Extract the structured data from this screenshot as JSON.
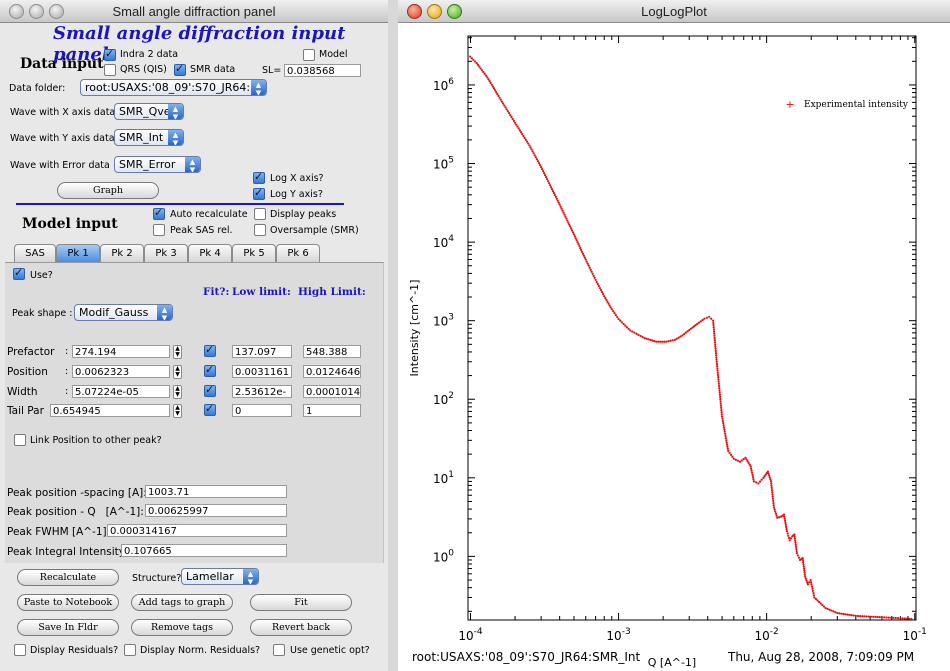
{
  "panel": {
    "window_title": "Small angle diffraction panel",
    "header": "Small angle diffraction input panel",
    "data_input": {
      "section_title": "Data input",
      "indra2_label": "Indra 2 data",
      "qrs_label": "QRS (QIS)",
      "smr_label": "SMR data",
      "model_label": "Model",
      "sl_label": "SL=",
      "sl_value": "0.038568",
      "data_folder_label": "Data folder:",
      "data_folder_value": "root:USAXS:'08_09':S70_JR64:",
      "x_wave_label": "Wave with X axis data",
      "x_wave_value": "SMR_Qvec",
      "y_wave_label": "Wave with Y axis data",
      "y_wave_value": "SMR_Int",
      "err_wave_label": "Wave with Error data",
      "err_wave_value": "SMR_Error",
      "graph_button": "Graph",
      "log_x_label": "Log X axis?",
      "log_y_label": "Log Y axis?"
    },
    "model_input": {
      "section_title": "Model input",
      "auto_recalc_label": "Auto recalculate",
      "display_peaks_label": "Display peaks",
      "peak_sas_label": "Peak SAS rel.",
      "oversample_label": "Oversample (SMR)",
      "tabs": [
        "SAS",
        "Pk 1",
        "Pk 2",
        "Pk 3",
        "Pk 4",
        "Pk 5",
        "Pk 6"
      ],
      "use_label": "Use?",
      "fit_header": "Fit?:",
      "low_header": "Low limit:",
      "high_header": "High Limit:",
      "peak_shape_label": "Peak shape :",
      "peak_shape_value": "Modif_Gauss",
      "params": [
        {
          "label": "Prefactor",
          "value": "274.194",
          "low": "137.097",
          "high": "548.388"
        },
        {
          "label": "Position",
          "value": "0.0062323",
          "low": "0.0031161",
          "high": "0.0124646"
        },
        {
          "label": "Width",
          "value": "5.07224e-05",
          "low": "2.53612e-",
          "high": "0.0001014"
        },
        {
          "label": "Tail Par",
          "value": "0.654945",
          "low": "0",
          "high": "1"
        }
      ],
      "link_label": "Link Position to other peak?",
      "results": [
        {
          "label": "Peak position -spacing [A]:",
          "value": "1003.71"
        },
        {
          "label": "Peak position - Q   [A^-1]:",
          "value": "0.00625997"
        },
        {
          "label": "Peak FWHM [A^-1]:",
          "value": "0.000314167"
        },
        {
          "label": "Peak Integral Intensity:",
          "value": "0.107665"
        }
      ]
    },
    "buttons": {
      "recalculate": "Recalculate",
      "structure_label": "Structure?",
      "structure_value": "Lamellar",
      "paste_notebook": "Paste to Notebook",
      "add_tags": "Add tags to graph",
      "fit": "Fit",
      "save_fldr": "Save In Fldr",
      "remove_tags": "Remove tags",
      "revert_back": "Revert back",
      "display_residuals": "Display Residuals?",
      "display_norm_residuals": "Display Norm. Residuals?",
      "use_genetic": "Use genetic opt?"
    }
  },
  "graph": {
    "window_title": "LogLogPlot",
    "footer_left": "root:USAXS:'08_09':S70_JR64:SMR_Int",
    "footer_right": "Thu, Aug 28, 2008, 7:09:09 PM"
  },
  "chart_data": {
    "type": "scatter",
    "title": "",
    "xlabel": "Q [A^-1]",
    "ylabel": "Intensity [cm^-1]",
    "xscale": "log",
    "yscale": "log",
    "xlim": [
      9.62e-05,
      0.102
    ],
    "ylim": [
      0.155,
      4200000
    ],
    "xticks": [
      "10^-4",
      "10^-3",
      "10^-2",
      "10^-1"
    ],
    "yticks": [
      "10^0",
      "10^1",
      "10^2",
      "10^3",
      "10^4",
      "10^5",
      "10^6"
    ],
    "legend": "top-right",
    "grid": false,
    "color": "#e01010",
    "series": [
      {
        "name": "Experimental intensity",
        "points": [
          [
            9.95e-05,
            2300000
          ],
          [
            0.00011,
            1900000
          ],
          [
            0.00013,
            1250000
          ],
          [
            0.00016,
            650000
          ],
          [
            0.0002,
            330000
          ],
          [
            0.00025,
            170000
          ],
          [
            0.0003,
            90000
          ],
          [
            0.00035,
            50000
          ],
          [
            0.0004,
            30000
          ],
          [
            0.0005,
            12500
          ],
          [
            0.0006,
            6000
          ],
          [
            0.0007,
            3300
          ],
          [
            0.0008,
            2050
          ],
          [
            0.0009,
            1400
          ],
          [
            0.001,
            1050
          ],
          [
            0.0012,
            750
          ],
          [
            0.0015,
            600
          ],
          [
            0.0018,
            540
          ],
          [
            0.0021,
            540
          ],
          [
            0.0024,
            570
          ],
          [
            0.0027,
            650
          ],
          [
            0.003,
            760
          ],
          [
            0.0034,
            910
          ],
          [
            0.0038,
            1060
          ],
          [
            0.0041,
            1120
          ],
          [
            0.00435,
            1000
          ],
          [
            0.0046,
            300
          ],
          [
            0.005,
            60
          ],
          [
            0.0055,
            22
          ],
          [
            0.006,
            17.5
          ],
          [
            0.0066,
            16
          ],
          [
            0.0072,
            18
          ],
          [
            0.0078,
            14
          ],
          [
            0.0082,
            9
          ],
          [
            0.0088,
            8.5
          ],
          [
            0.0095,
            10
          ],
          [
            0.0102,
            12
          ],
          [
            0.0107,
            9
          ],
          [
            0.0112,
            4.2
          ],
          [
            0.0118,
            3.1
          ],
          [
            0.0125,
            3.2
          ],
          [
            0.0131,
            3.4
          ],
          [
            0.0137,
            2.1
          ],
          [
            0.0143,
            1.6
          ],
          [
            0.0149,
            1.8
          ],
          [
            0.0154,
            1.9
          ],
          [
            0.016,
            1.1
          ],
          [
            0.0168,
            0.9
          ],
          [
            0.0175,
            0.95
          ],
          [
            0.0182,
            0.55
          ],
          [
            0.019,
            0.44
          ],
          [
            0.0198,
            0.5
          ],
          [
            0.021,
            0.3
          ],
          [
            0.025,
            0.22
          ],
          [
            0.03,
            0.19
          ],
          [
            0.04,
            0.175
          ],
          [
            0.06,
            0.168
          ],
          [
            0.08,
            0.163
          ],
          [
            0.095,
            0.16
          ]
        ]
      }
    ]
  }
}
